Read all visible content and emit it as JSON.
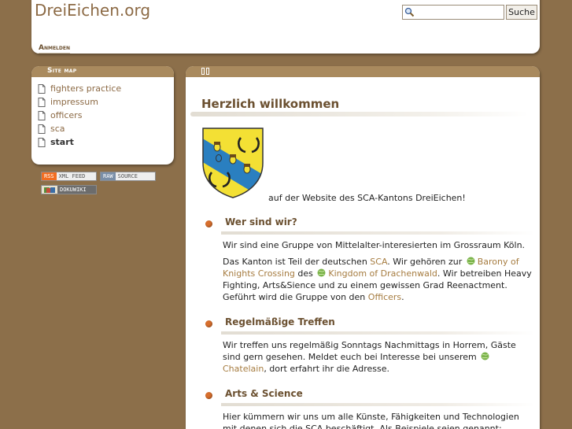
{
  "header": {
    "site_title": "DreiEichen.org",
    "search_placeholder": "",
    "search_button": "Suche",
    "login_label": "Anmelden"
  },
  "sidebar": {
    "title": "Site map",
    "items": [
      {
        "label": "fighters practice",
        "current": false
      },
      {
        "label": "impressum",
        "current": false
      },
      {
        "label": "officers",
        "current": false
      },
      {
        "label": "sca",
        "current": false
      },
      {
        "label": "start",
        "current": true
      }
    ]
  },
  "badges": {
    "rss_left": "RSS",
    "rss_right": "XML FEED",
    "raw_left": "RAW",
    "raw_right": "SOURCE",
    "doku_right": "DOKUWIKI"
  },
  "content": {
    "title": "Herzlich willkommen",
    "welcome_text": "auf der Website des SCA-Kantons DreiEichen!",
    "sections": [
      {
        "heading": "Wer sind wir?",
        "p1": "Wir sind eine Gruppe von Mittelalter-interesierten im Grossraum Köln.",
        "p2_a": "Das Kanton ist Teil der deutschen ",
        "p2_link_sca": "SCA",
        "p2_b": ". Wir gehören zur ",
        "p2_link_barony": "Barony of Knights Crossing",
        "p2_c": " des ",
        "p2_link_kingdom": "Kingdom of Drachenwald",
        "p2_d": ". Wir betreiben Heavy Fighting, Arts&Sience und zu einem gewissen Grad Reenactment. Geführt wird die Gruppe von den ",
        "p2_link_officers": "Officers",
        "p2_e": "."
      },
      {
        "heading": "Regelmäßige Treffen",
        "p1_a": "Wir treffen uns regelmäßig Sonntags Nachmittags in Horrem, Gäste sind gern gesehen. Meldet euch bei Interesse bei unserem ",
        "p1_link": "Chatelain",
        "p1_b": ", dort erfahrt ihr die Adresse."
      },
      {
        "heading": "Arts & Science",
        "p1": "Hier kümmern wir uns um alle Künste, Fähigkeiten und Technologien mit denen sich die SCA beschäftigt. Als Beispiele seien genannt: Herstellen unserer"
      }
    ]
  },
  "colors": {
    "background": "#8c6f4a",
    "accent": "#a98a5e",
    "heading": "#6b5030",
    "link": "#a67c40",
    "bullet": "#d86f2d",
    "shield_yellow": "#f3e034",
    "shield_blue": "#2a7fc0"
  },
  "icons": [
    "search-icon",
    "page-icon",
    "globe-icon",
    "bullet-icon",
    "coat-of-arms"
  ]
}
